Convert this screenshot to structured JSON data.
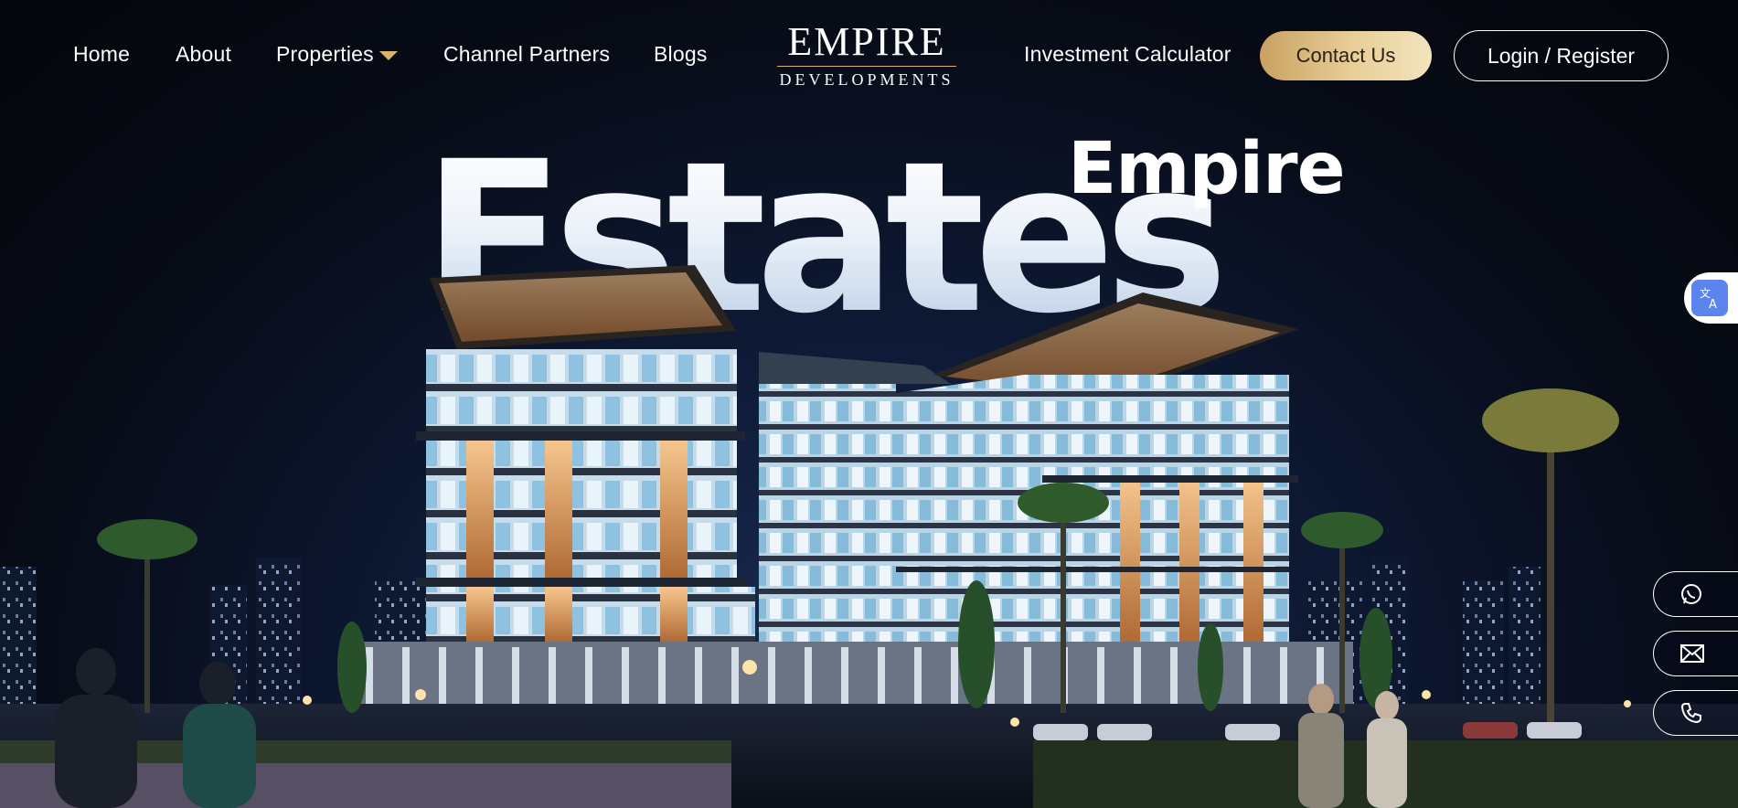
{
  "nav": {
    "home": "Home",
    "about": "About",
    "properties": "Properties",
    "channel_partners": "Channel Partners",
    "blogs": "Blogs",
    "investment_calculator": "Investment Calculator",
    "contact": "Contact Us",
    "login": "Login / Register"
  },
  "logo": {
    "top": "EMPIRE",
    "sub": "DEVELOPMENTS"
  },
  "hero": {
    "word_small": "Empire",
    "word_large": "Estates"
  },
  "icons": {
    "translate": "translate-icon",
    "whatsapp": "whatsapp-icon",
    "email": "mail-icon",
    "phone": "phone-icon",
    "dropdown": "caret-down-icon"
  },
  "colors": {
    "accent_gold": "#d9b46c",
    "contact_gradient_start": "#c9a162",
    "contact_gradient_end": "#f3e4bd",
    "translate_blue": "#5b84ee",
    "background": "#05070d"
  }
}
